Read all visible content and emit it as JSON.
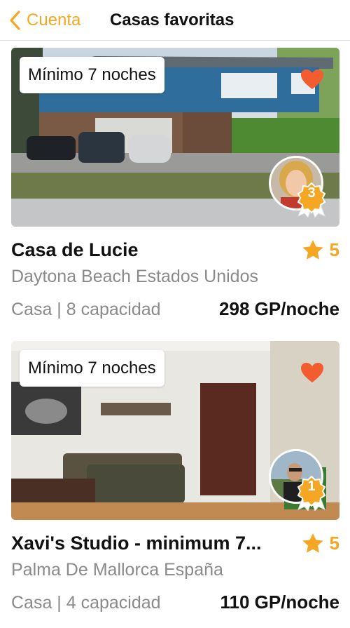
{
  "nav": {
    "back_label": "Cuenta",
    "title": "Casas favoritas"
  },
  "colors": {
    "accent": "#f5a623",
    "heart": "#f25c2f",
    "secondary_text": "#8a8a8a"
  },
  "listings": [
    {
      "min_nights": "Mínimo 7 noches",
      "title": "Casa de Lucie",
      "rating": "5",
      "location": "Daytona Beach Estados Unidos",
      "meta": "Casa | 8 capacidad",
      "price": "298 GP/noche",
      "host_level": "3",
      "favorited": true,
      "icons": [
        "heart-icon",
        "medal-icon",
        "star-icon"
      ]
    },
    {
      "min_nights": "Mínimo 7 noches",
      "title": "Xavi's Studio - minimum 7...",
      "rating": "5",
      "location": "Palma De Mallorca España",
      "meta": "Casa | 4 capacidad",
      "price": "110 GP/noche",
      "host_level": "1",
      "favorited": true,
      "icons": [
        "heart-icon",
        "medal-icon",
        "star-icon"
      ]
    }
  ]
}
